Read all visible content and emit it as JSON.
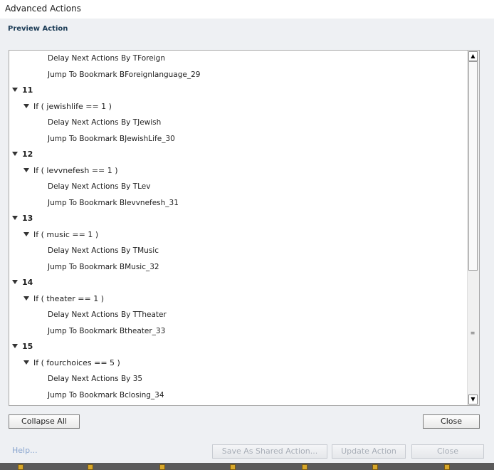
{
  "window": {
    "title": "Advanced Actions"
  },
  "preview": {
    "section_label": "Preview Action"
  },
  "tree": [
    {
      "kind": "action",
      "text": "Delay Next Actions By TForeign"
    },
    {
      "kind": "action",
      "text": "Jump To Bookmark BForeignlanguage_29"
    },
    {
      "kind": "step",
      "text": "11"
    },
    {
      "kind": "cond",
      "text": "If ( jewishlife == 1  )"
    },
    {
      "kind": "action",
      "text": "Delay Next Actions By TJewish"
    },
    {
      "kind": "action",
      "text": "Jump To Bookmark BJewishLife_30"
    },
    {
      "kind": "step",
      "text": "12"
    },
    {
      "kind": "cond",
      "text": "If ( levvnefesh == 1  )"
    },
    {
      "kind": "action",
      "text": "Delay Next Actions By TLev"
    },
    {
      "kind": "action",
      "text": "Jump To Bookmark Blevvnefesh_31"
    },
    {
      "kind": "step",
      "text": "13"
    },
    {
      "kind": "cond",
      "text": "If ( music == 1  )"
    },
    {
      "kind": "action",
      "text": "Delay Next Actions By TMusic"
    },
    {
      "kind": "action",
      "text": "Jump To Bookmark BMusic_32"
    },
    {
      "kind": "step",
      "text": "14"
    },
    {
      "kind": "cond",
      "text": "If ( theater == 1  )"
    },
    {
      "kind": "action",
      "text": "Delay Next Actions By TTheater"
    },
    {
      "kind": "action",
      "text": "Jump To Bookmark Btheater_33"
    },
    {
      "kind": "step",
      "text": "15"
    },
    {
      "kind": "cond",
      "text": "If ( fourchoices == 5  )"
    },
    {
      "kind": "action",
      "text": "Delay Next Actions By 35"
    },
    {
      "kind": "action",
      "text": "Jump To Bookmark Bclosing_34"
    }
  ],
  "buttons": {
    "collapse_all": "Collapse All",
    "close_preview": "Close",
    "help": "Help...",
    "save_shared": "Save As Shared Action...",
    "update_action": "Update Action",
    "close_dialog": "Close"
  },
  "scrollbar": {
    "up_arrow": "▲",
    "down_arrow": "▼",
    "grip": "≡"
  }
}
